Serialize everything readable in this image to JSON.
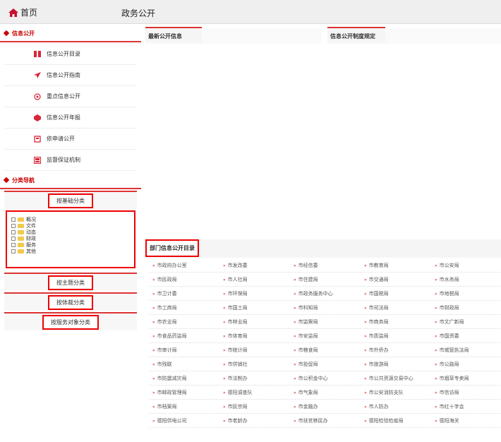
{
  "header": {
    "home_label": "首页",
    "section_title": "政务公开"
  },
  "sidebar": {
    "info_title": "信息公开",
    "items": [
      {
        "label": "信息公开目录",
        "icon": "book-icon",
        "color": "#d9263a"
      },
      {
        "label": "信息公开指南",
        "icon": "paper-plane-icon",
        "color": "#d9263a"
      },
      {
        "label": "重点信息公开",
        "icon": "circle-badge-icon",
        "color": "#d9263a"
      },
      {
        "label": "信息公开年报",
        "icon": "cube-icon",
        "color": "#d9263a"
      },
      {
        "label": "依申请公开",
        "icon": "document-icon",
        "color": "#d9263a"
      },
      {
        "label": "监督保证机制",
        "icon": "monitor-icon",
        "color": "#d9263a"
      }
    ],
    "nav_title": "分类导航",
    "by_org_btn": "按基础分类",
    "tree": [
      "概况",
      "文件",
      "动态",
      "财政",
      "服务",
      "其他"
    ],
    "by_topic_btn": "按主题分类",
    "by_genre_btn": "按体裁分类",
    "by_service_btn": "按服务对象分类"
  },
  "main": {
    "tab_latest": "最新公开信息",
    "tab_rules": "信息公开制度规定",
    "dept_title": "部门信息公开目录",
    "departments": [
      "市政府办公室",
      "市发改委",
      "市经信委",
      "市教育局",
      "市公安局",
      "市民政局",
      "市人社局",
      "市住建局",
      "市交通局",
      "市水务局",
      "市卫计委",
      "市环保局",
      "市政务服务中心",
      "市国税局",
      "市地税局",
      "市工商局",
      "市国土局",
      "市科知局",
      "市司法局",
      "市财政局",
      "市农业局",
      "市林业局",
      "市监察局",
      "市商务局",
      "市文广新局",
      "市食品药监局",
      "市体育局",
      "市安监局",
      "市质监局",
      "市国资委",
      "市审计局",
      "市统计局",
      "市粮食局",
      "市外侨办",
      "市城管执法局",
      "市残联",
      "市供销社",
      "市投促局",
      "市旅游局",
      "市公路局",
      "市防震减灾局",
      "市法制办",
      "市公积金中心",
      "市公共资源交易中心",
      "市烟草专卖局",
      "市邮政管理局",
      "德阳调查队",
      "市气象局",
      "市公安消防支队",
      "市信访局",
      "市档案局",
      "市民宗局",
      "市金融办",
      "市人防办",
      "市红十字会",
      "德阳供电公司",
      "市老龄办",
      "市扶贫移民办",
      "德阳检验检疫局",
      "德阳海关"
    ]
  }
}
